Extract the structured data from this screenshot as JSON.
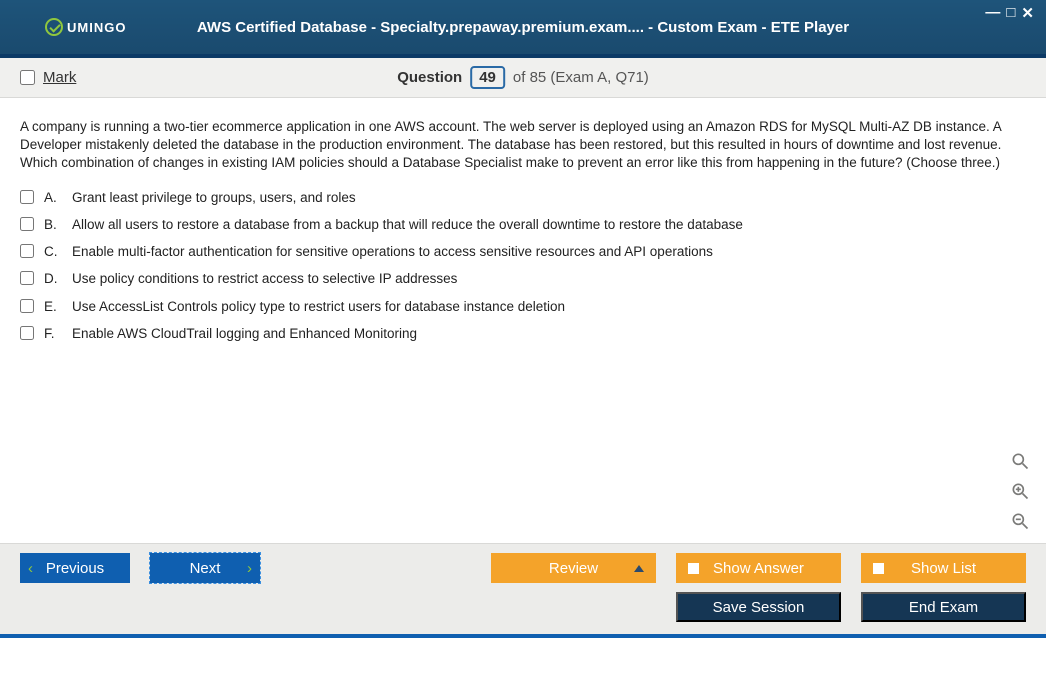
{
  "window": {
    "logo_text": "UMINGO",
    "title": "AWS Certified Database - Specialty.prepaway.premium.exam.... - Custom Exam - ETE Player"
  },
  "header": {
    "mark_label": "Mark",
    "question_word": "Question",
    "current_number": "49",
    "total_text": "of 85 (Exam A, Q71)"
  },
  "question": {
    "text": "A company is running a two-tier ecommerce application in one AWS account. The web server is deployed using an Amazon RDS for MySQL Multi-AZ DB instance. A Developer mistakenly deleted the database in the production environment. The database has been restored, but this resulted in hours of downtime and lost revenue. Which combination of changes in existing IAM policies should a Database Specialist make to prevent an error like this from happening in the future? (Choose three.)",
    "options": [
      {
        "letter": "A.",
        "text": "Grant least privilege to groups, users, and roles"
      },
      {
        "letter": "B.",
        "text": "Allow all users to restore a database from a backup that will reduce the overall downtime to restore the database"
      },
      {
        "letter": "C.",
        "text": "Enable multi-factor authentication for sensitive operations to access sensitive resources and API operations"
      },
      {
        "letter": "D.",
        "text": "Use policy conditions to restrict access to selective IP addresses"
      },
      {
        "letter": "E.",
        "text": "Use AccessList Controls policy type to restrict users for database instance deletion"
      },
      {
        "letter": "F.",
        "text": "Enable AWS CloudTrail logging and Enhanced Monitoring"
      }
    ]
  },
  "buttons": {
    "previous": "Previous",
    "next": "Next",
    "review": "Review",
    "show_answer": "Show Answer",
    "show_list": "Show List",
    "save_session": "Save Session",
    "end_exam": "End Exam"
  }
}
